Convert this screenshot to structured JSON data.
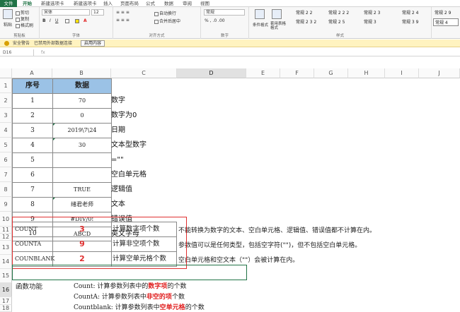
{
  "ribbon_tabs": [
    "文件",
    "开始",
    "新建选项卡",
    "新建选项卡",
    "插入",
    "页面布局",
    "公式",
    "数据",
    "审阅",
    "视图"
  ],
  "active_tab": "开始",
  "ribbon": {
    "paste": "粘贴",
    "cut": "剪切",
    "copy": "复制",
    "format_painter": "格式刷",
    "clipboard": "剪贴板",
    "font_name": "宋体",
    "font_size": "12",
    "font_group": "字体",
    "wrap_text": "自动换行",
    "merge_center": "合并后居中",
    "align_group": "对齐方式",
    "number_format": "常规",
    "number_group": "数字",
    "cond_format": "条件格式",
    "table_format": "套用表格格式",
    "styles": [
      "常规 2 2",
      "常规 2 2 2",
      "常规 2 3",
      "常规 2 4",
      "常规 2 9",
      "常规 2 3 2",
      "常规 2 5",
      "常规 3",
      "常规 3 9",
      "常规 4"
    ],
    "styles_group": "样式"
  },
  "security": {
    "title": "安全警告",
    "message": "已禁用外部数据连接",
    "button": "启用内容"
  },
  "formula_bar": {
    "name_box": "D16",
    "fx": "fx",
    "content": ""
  },
  "columns": [
    "A",
    "B",
    "C",
    "D",
    "E",
    "F",
    "G",
    "H",
    "I",
    "J"
  ],
  "rows": [
    "1",
    "2",
    "3",
    "4",
    "5",
    "6",
    "7",
    "8",
    "9",
    "10",
    "11",
    "12",
    "13",
    "14",
    "15",
    "16",
    "17",
    "18"
  ],
  "table": {
    "header": [
      "序号",
      "数据"
    ],
    "rows": [
      {
        "a": "1",
        "b": "70",
        "c": "数字"
      },
      {
        "a": "2",
        "b": "0",
        "c": "数字为0"
      },
      {
        "a": "3",
        "b": "2019\\7\\24",
        "c": "日期"
      },
      {
        "a": "4",
        "b": "30",
        "c": "文本型数字"
      },
      {
        "a": "5",
        "b": "",
        "c": "=\"\""
      },
      {
        "a": "6",
        "b": "",
        "c": "空白单元格"
      },
      {
        "a": "7",
        "b": "TRUE",
        "c": "逻辑值"
      },
      {
        "a": "8",
        "b": "绪君老师",
        "c": "文本"
      },
      {
        "a": "9",
        "b": "#DIV/0!",
        "c": "错误值"
      },
      {
        "a": "10",
        "b": "ABCD",
        "c": "英文字母"
      }
    ]
  },
  "functions": [
    {
      "name": "COUNT",
      "result": "3",
      "desc": "计算数字项个数",
      "note": "不能转换为数字的文本、空白单元格、逻辑值、错误值都不计算在内。"
    },
    {
      "name": "COUNTA",
      "result": "9",
      "desc": "计算非空项个数",
      "note": "参数值可以是任何类型，包括空字符(\"\")，但不包括空白单元格。"
    },
    {
      "name": "COUNBLANK",
      "result": "2",
      "desc": "计算空单元格个数",
      "note": "空白单元格和空文本（\"\"）会被计算在内。"
    }
  ],
  "legend": {
    "label": "函数功能",
    "lines": [
      {
        "pre": "Count:  计算参数列表中的",
        "hl": "数字项",
        "post": "的个数"
      },
      {
        "pre": "CountA: 计算参数列表中",
        "hl": "非空的项",
        "post": "个数"
      },
      {
        "pre": "Countblank: 计算参数列表中",
        "hl": "空单元格",
        "post": "的个数"
      }
    ]
  },
  "colors": {
    "header_fill": "#9bc2e6",
    "highlight": "#e02020",
    "accent": "#217346"
  }
}
